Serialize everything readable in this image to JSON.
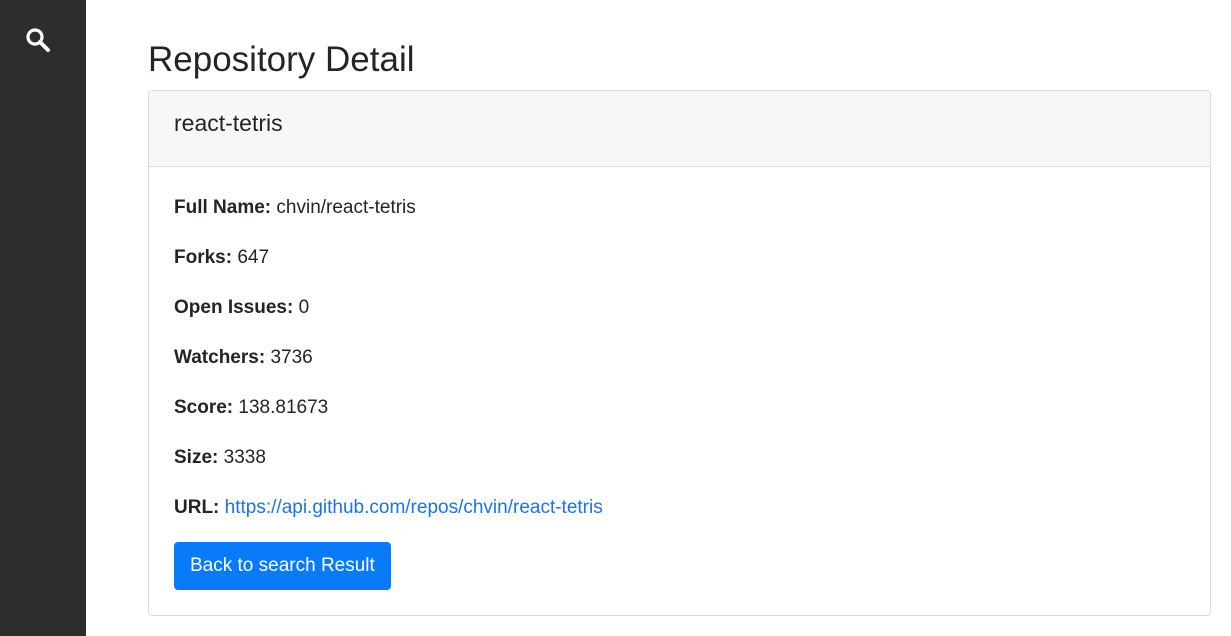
{
  "sidebar": {
    "search_icon": "search-icon"
  },
  "page": {
    "title": "Repository Detail"
  },
  "repo": {
    "name": "react-tetris",
    "fields": [
      {
        "label": "Full Name:",
        "value": "chvin/react-tetris"
      },
      {
        "label": "Forks:",
        "value": "647"
      },
      {
        "label": "Open Issues:",
        "value": "0"
      },
      {
        "label": "Watchers:",
        "value": "3736"
      },
      {
        "label": "Score:",
        "value": "138.81673"
      },
      {
        "label": "Size:",
        "value": "3338"
      },
      {
        "label": "URL:",
        "value": "https://api.github.com/repos/chvin/react-tetris"
      }
    ]
  },
  "actions": {
    "back_label": "Back to search Result"
  },
  "colors": {
    "sidebar": "#2c2e2d",
    "link": "#1a73e8",
    "primary": "#0a7bf8"
  }
}
